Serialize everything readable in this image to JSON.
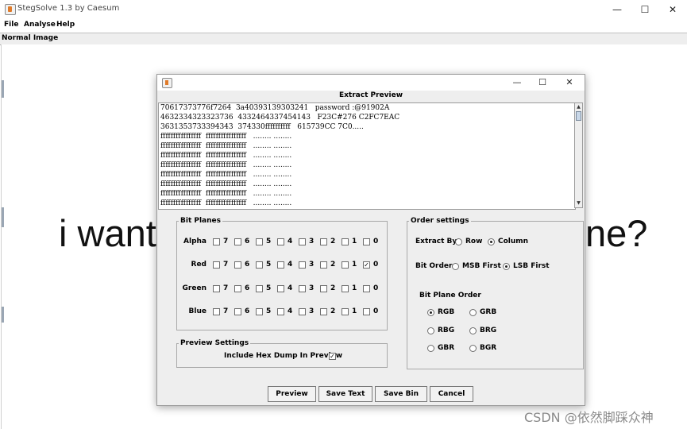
{
  "window": {
    "title": "StegSolve 1.3 by Caesum",
    "controls": [
      "—",
      "☐",
      "✕"
    ]
  },
  "menu": [
    "File",
    "Analyse",
    "Help"
  ],
  "frame_label": "Normal Image",
  "background_text": {
    "left": "i want",
    "right": "ne?"
  },
  "dialog": {
    "controls": [
      "—",
      "☐",
      "✕"
    ],
    "title": "Extract Preview",
    "preview_lines": [
      "70617373776f7264  3a40393139303241   password :@91902A",
      "4632334323323736  4332464337454143   F23C#276 C2FC7EAC",
      "3631353733394343  374330ffffffffff   615739CC 7C0.....",
      "ffffffffffffffff  ffffffffffffffff   ........ ........",
      "ffffffffffffffff  ffffffffffffffff   ........ ........",
      "ffffffffffffffff  ffffffffffffffff   ........ ........",
      "ffffffffffffffff  ffffffffffffffff   ........ ........",
      "ffffffffffffffff  ffffffffffffffff   ........ ........",
      "ffffffffffffffff  ffffffffffffffff   ........ ........",
      "ffffffffffffffff  ffffffffffffffff   ........ ........",
      "ffffffffffffffff  ffffffffffffffff   ........ ........"
    ],
    "bit_planes": {
      "legend": "Bit Planes",
      "bits": [
        "7",
        "6",
        "5",
        "4",
        "3",
        "2",
        "1",
        "0"
      ],
      "channels": [
        {
          "label": "Alpha",
          "checked": []
        },
        {
          "label": "Red",
          "checked": [
            "0"
          ]
        },
        {
          "label": "Green",
          "checked": []
        },
        {
          "label": "Blue",
          "checked": []
        }
      ]
    },
    "preview_settings": {
      "legend": "Preview Settings",
      "hex_dump_label": "Include Hex Dump In Preview",
      "hex_dump_checked": true
    },
    "order_settings": {
      "legend": "Order settings",
      "extract_by": {
        "label": "Extract By",
        "options": [
          "Row",
          "Column"
        ],
        "selected": "Column"
      },
      "bit_order": {
        "label": "Bit Order",
        "options": [
          "MSB First",
          "LSB First"
        ],
        "selected": "LSB First"
      },
      "bit_plane_order": {
        "label": "Bit Plane Order",
        "options": [
          "RGB",
          "GRB",
          "RBG",
          "BRG",
          "GBR",
          "BGR"
        ],
        "selected": "RGB"
      }
    },
    "buttons": {
      "preview": "Preview",
      "save_text": "Save Text",
      "save_bin": "Save Bin",
      "cancel": "Cancel"
    }
  },
  "watermark": "CSDN @依然脚踩众神"
}
